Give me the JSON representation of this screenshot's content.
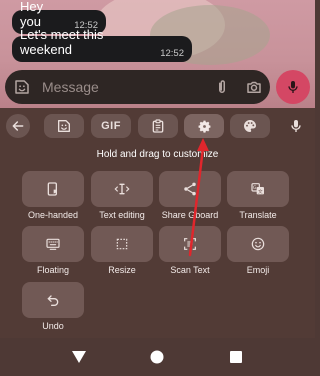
{
  "chat": {
    "messages": [
      {
        "text": "Hey you",
        "time": "12:52"
      },
      {
        "text": "Let's meet this weekend",
        "time": "12:52"
      }
    ]
  },
  "composer": {
    "placeholder": "Message",
    "icons": [
      "emoji-icon",
      "attach-icon",
      "camera-icon",
      "mic-icon"
    ]
  },
  "keyboard_toolbar": {
    "items": [
      "back",
      "sticker",
      "gif",
      "clipboard",
      "settings",
      "theme",
      "mic"
    ],
    "gif_label": "GIF",
    "active_item": "settings"
  },
  "customize": {
    "hint": "Hold and drag to customize",
    "tiles": [
      {
        "label": "One-handed",
        "icon": "one-handed-icon"
      },
      {
        "label": "Text editing",
        "icon": "text-editing-icon"
      },
      {
        "label": "Share Gboard",
        "icon": "share-icon"
      },
      {
        "label": "Translate",
        "icon": "translate-icon"
      },
      {
        "label": "Floating",
        "icon": "floating-keyboard-icon"
      },
      {
        "label": "Resize",
        "icon": "resize-icon"
      },
      {
        "label": "Scan Text",
        "icon": "scan-text-icon"
      },
      {
        "label": "Emoji",
        "icon": "emoji-icon"
      },
      {
        "label": "Undo",
        "icon": "undo-icon"
      }
    ]
  },
  "navbar": {
    "buttons": [
      "back",
      "home",
      "recents"
    ]
  },
  "colors": {
    "keyboard_bg": "#523b36",
    "tile_bg": "#715955",
    "mic_accent": "#d44764",
    "annotation_arrow": "#e0262c"
  }
}
